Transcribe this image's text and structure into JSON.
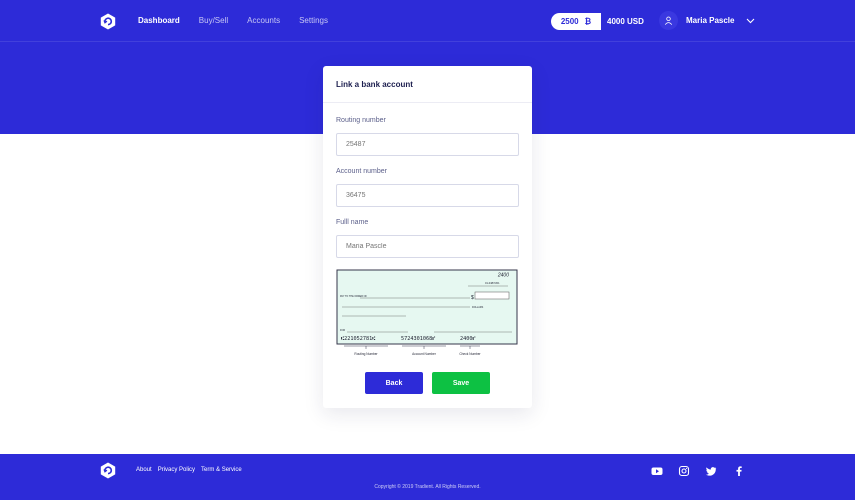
{
  "nav": {
    "links": [
      {
        "label": "Dashboard",
        "active": true
      },
      {
        "label": "Buy/Sell",
        "active": false
      },
      {
        "label": "Accounts",
        "active": false
      },
      {
        "label": "Settings",
        "active": false
      }
    ]
  },
  "balance": {
    "btc_amount": "2500",
    "btc_symbol": "₿",
    "usd_amount": "4000 USD"
  },
  "user": {
    "name": "Maria Pascle"
  },
  "card": {
    "title": "Link a bank account",
    "routing": {
      "label": "Routing number",
      "placeholder": "25487"
    },
    "account": {
      "label": "Account number",
      "placeholder": "36475"
    },
    "fullname": {
      "label": "Fulll name",
      "placeholder": "Maria Pascle"
    },
    "cheque": {
      "check_no": "2400",
      "fraction": "01-0487/201",
      "pay_to": "PAY TO THE ORDER OF",
      "dollar_sign": "$",
      "dollars": "DOLLARS",
      "for_label": "FOR",
      "micr_routing": "⑆221052781⑆",
      "micr_account": "5724301068⑈",
      "micr_check": "2400⑈",
      "caption_routing": "Routing Number",
      "caption_account": "Account Number",
      "caption_check": "Check Number"
    },
    "back_label": "Back",
    "save_label": "Save"
  },
  "footer": {
    "links": [
      "About",
      "Privacy Policy",
      "Term & Service"
    ],
    "copyright": "Copyright © 2019 Tradient. All Rights Reserved."
  },
  "colors": {
    "brand": "#2d2bd8",
    "success": "#0dc143",
    "cheque_bg": "#e6f8f1"
  }
}
